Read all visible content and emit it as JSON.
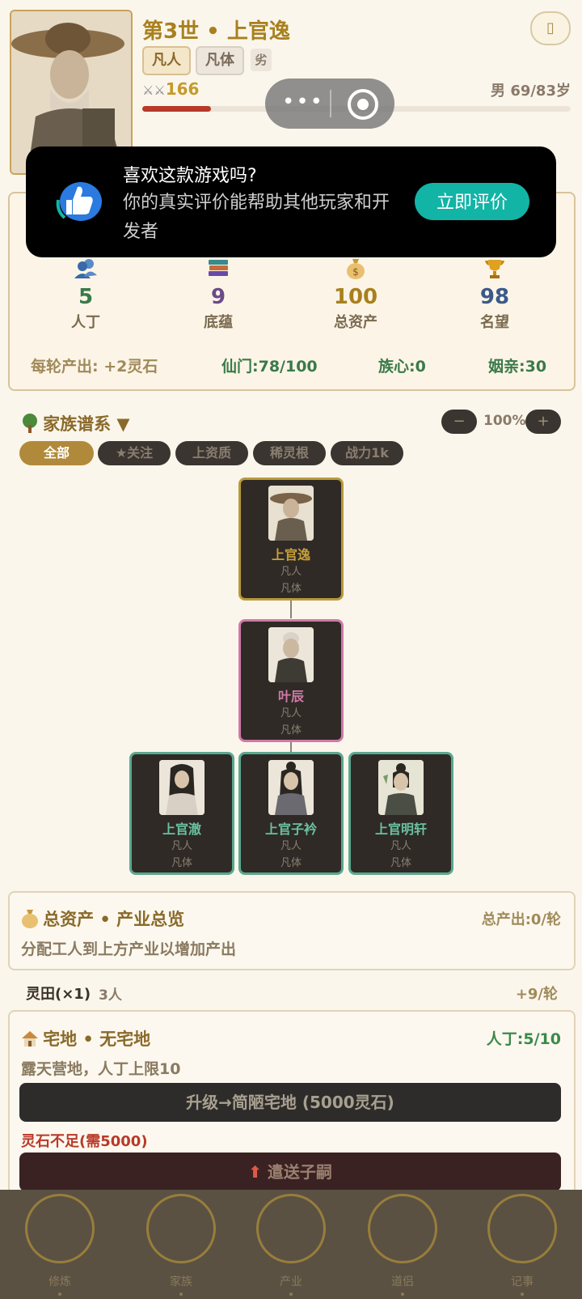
{
  "header": {
    "title": "第3世 • 上官逸",
    "tag_fanren": "凡人",
    "tag_fanti": "凡体",
    "tag_lie": "劣",
    "power": "166",
    "age": "男 69/83岁",
    "hp_percent": 16,
    "menu_icon": "▯"
  },
  "capsule": {
    "more": "•••"
  },
  "toast": {
    "title": "喜欢这款游戏吗?",
    "body": "你的真实评价能帮助其他玩家和开发者",
    "button": "立即评价"
  },
  "stats": {
    "items": [
      {
        "value": "5",
        "label": "人丁",
        "color": "#3a7a4a"
      },
      {
        "value": "9",
        "label": "底蕴",
        "color": "#6a4a8a"
      },
      {
        "value": "100",
        "label": "总资产",
        "color": "#a8801e"
      },
      {
        "value": "98",
        "label": "名望",
        "color": "#3a5a8a"
      }
    ],
    "income": "每轮产出: +2灵石",
    "sect": "仙门:78/100",
    "clan": "族心:0",
    "marriage": "姻亲:30"
  },
  "tree": {
    "title": "家族谱系 ▼",
    "zoom_out": "−",
    "zoom_in": "+",
    "zoom_value": "100%",
    "filters": [
      "全部",
      "★关注",
      "上资质",
      "稀灵根",
      "战力1k"
    ],
    "members": [
      {
        "name": "上官逸",
        "rank": "凡人",
        "body": "凡体"
      },
      {
        "name": "叶辰",
        "rank": "凡人",
        "body": "凡体"
      },
      {
        "name": "上官澈",
        "rank": "凡人",
        "body": "凡体"
      },
      {
        "name": "上官子衿",
        "rank": "凡人",
        "body": "凡体"
      },
      {
        "name": "上官明轩",
        "rank": "凡人",
        "body": "凡体"
      }
    ]
  },
  "assets": {
    "title": "总资产 • 产业总览",
    "total_output": "总产出:0/轮",
    "hint": "分配工人到上方产业以增加产出",
    "field_name": "灵田(×1)",
    "field_workers": "3人",
    "field_output": "+9/轮"
  },
  "homestead": {
    "title": "宅地 • 无宅地",
    "population": "人丁:5/10",
    "desc": "露天营地，人丁上限10",
    "upgrade_button": "升级→简陋宅地 (5000灵石)",
    "warning": "灵石不足(需5000)",
    "send_button": "遣送子嗣"
  },
  "nav": {
    "items": [
      "修炼",
      "家族",
      "产业",
      "道侣",
      "记事"
    ]
  }
}
